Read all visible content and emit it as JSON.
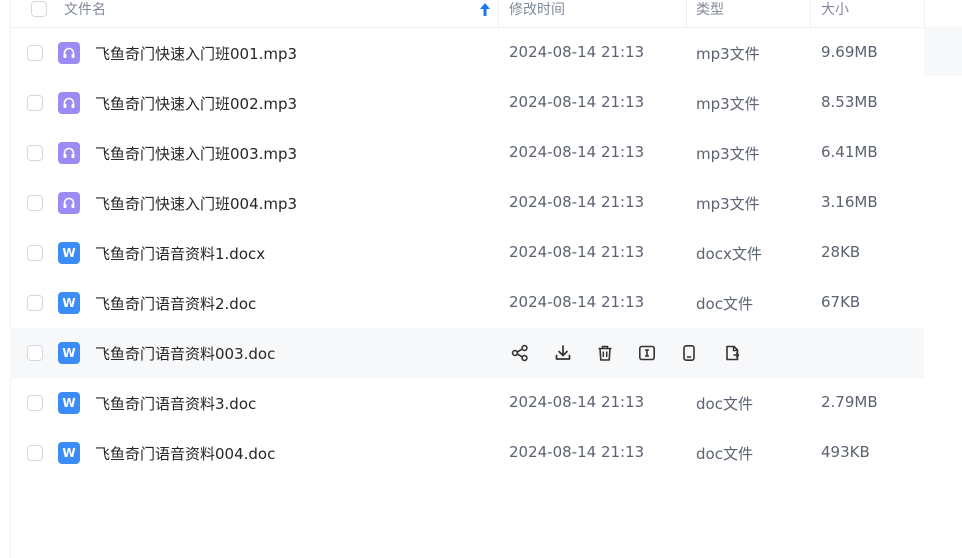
{
  "header": {
    "name_label": "文件名",
    "sort_icon": "sort-ascending-arrow-icon",
    "time_label": "修改时间",
    "type_label": "类型",
    "size_label": "大小"
  },
  "colors": {
    "accent": "#1677ff",
    "audio_icon": "#9b8cf5",
    "word_icon": "#3b8cf6",
    "hover_row": "#f7f8fa"
  },
  "files": [
    {
      "name": "飞鱼奇门快速入门班001.mp3",
      "time": "2024-08-14 21:13",
      "type": "mp3文件",
      "size": "9.69MB",
      "icon": "audio-file-icon"
    },
    {
      "name": "飞鱼奇门快速入门班002.mp3",
      "time": "2024-08-14 21:13",
      "type": "mp3文件",
      "size": "8.53MB",
      "icon": "audio-file-icon"
    },
    {
      "name": "飞鱼奇门快速入门班003.mp3",
      "time": "2024-08-14 21:13",
      "type": "mp3文件",
      "size": "6.41MB",
      "icon": "audio-file-icon"
    },
    {
      "name": "飞鱼奇门快速入门班004.mp3",
      "time": "2024-08-14 21:13",
      "type": "mp3文件",
      "size": "3.16MB",
      "icon": "audio-file-icon"
    },
    {
      "name": "飞鱼奇门语音资料1.docx",
      "time": "2024-08-14 21:13",
      "type": "docx文件",
      "size": "28KB",
      "icon": "word-file-icon"
    },
    {
      "name": "飞鱼奇门语音资料2.doc",
      "time": "2024-08-14 21:13",
      "type": "doc文件",
      "size": "67KB",
      "icon": "word-file-icon"
    },
    {
      "name": "飞鱼奇门语音资料003.doc",
      "time": "",
      "type": "",
      "size": "",
      "icon": "word-file-icon",
      "hovered": true,
      "actions": [
        "share-icon",
        "download-icon",
        "delete-icon",
        "rename-icon",
        "send-to-phone-icon",
        "copy-icon"
      ]
    },
    {
      "name": "飞鱼奇门语音资料3.doc",
      "time": "2024-08-14 21:13",
      "type": "doc文件",
      "size": "2.79MB",
      "icon": "word-file-icon"
    },
    {
      "name": "飞鱼奇门语音资料004.doc",
      "time": "2024-08-14 21:13",
      "type": "doc文件",
      "size": "493KB",
      "icon": "word-file-icon"
    }
  ]
}
